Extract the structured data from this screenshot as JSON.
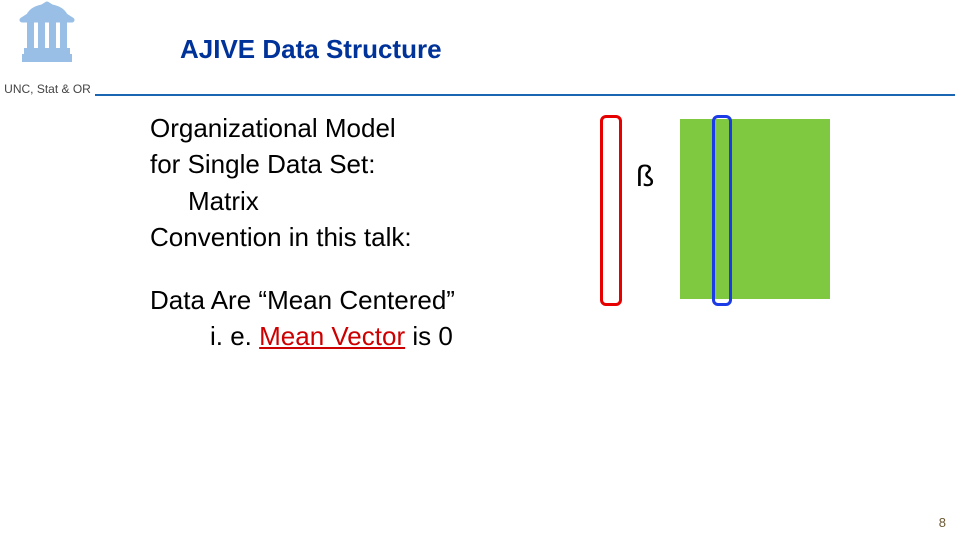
{
  "header": {
    "title": "AJIVE Data Structure",
    "dept": "UNC, Stat & OR"
  },
  "content": {
    "line1": "Organizational Model",
    "line2": "for Single Data Set:",
    "line3": "Matrix",
    "line4": "Convention in this talk:",
    "line5a": "Data Are ",
    "line5b": "“Mean Centered”",
    "line6a": "i. e. ",
    "line6b": "Mean Vector",
    "line6c": " is 0"
  },
  "diagram": {
    "arrow": "ß"
  },
  "page": {
    "number": "8"
  },
  "colors": {
    "title": "#003399",
    "rule": "#1a66b3",
    "red": "#cc0000",
    "green": "#7ec93f",
    "blue": "#1a3be6",
    "redBorder": "#e60000"
  }
}
